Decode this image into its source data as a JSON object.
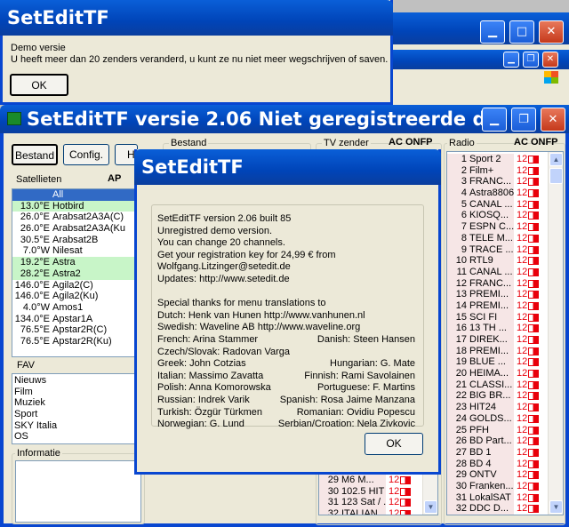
{
  "background_app": {
    "title": "SetEditTF versie  2.06  Niet geregistreerde d...",
    "buttons": {
      "bestand": "Bestand",
      "config": "Config.",
      "h": "H"
    },
    "groups": {
      "satellieten": "Satellieten",
      "bestand": "Bestand",
      "tv_zender": "TV zender",
      "radio": "Radio",
      "fav": "FAV",
      "informatie": "Informatie"
    },
    "sat_cols": "AP",
    "tv_cols": "AC ONFP",
    "radio_cols": "AC ONFP",
    "satellites": [
      {
        "pos": "",
        "name": "All",
        "hl": "sel"
      },
      {
        "pos": "13.0°E",
        "name": "Hotbird",
        "hl": "green"
      },
      {
        "pos": "26.0°E",
        "name": "Arabsat2A3A(C)",
        "hl": ""
      },
      {
        "pos": "26.0°E",
        "name": "Arabsat2A3A(Ku",
        "hl": ""
      },
      {
        "pos": "30.5°E",
        "name": "Arabsat2B",
        "hl": ""
      },
      {
        "pos": "7.0°W",
        "name": "Nilesat",
        "hl": ""
      },
      {
        "pos": "19.2°E",
        "name": "Astra",
        "hl": "green"
      },
      {
        "pos": "28.2°E",
        "name": "Astra2",
        "hl": "green"
      },
      {
        "pos": "146.0°E",
        "name": "Agila2(C)",
        "hl": ""
      },
      {
        "pos": "146.0°E",
        "name": "Agila2(Ku)",
        "hl": ""
      },
      {
        "pos": "4.0°W",
        "name": "Amos1",
        "hl": ""
      },
      {
        "pos": "134.0°E",
        "name": "Apstar1A",
        "hl": ""
      },
      {
        "pos": "76.5°E",
        "name": "Apstar2R(C)",
        "hl": ""
      },
      {
        "pos": "76.5°E",
        "name": "Apstar2R(Ku)",
        "hl": ""
      }
    ],
    "fav_list": [
      "Nieuws",
      "Film",
      "Muziek",
      "Sport",
      "SKY Italia",
      "OS"
    ],
    "tv_channels": [
      {
        "num": "29",
        "name": "M6 M..."
      },
      {
        "num": "30",
        "name": "102.5 HIT ..."
      },
      {
        "num": "31",
        "name": "123 Sat / ..."
      },
      {
        "num": "32",
        "name": "ITALIAN..."
      }
    ],
    "radio_channels": [
      {
        "num": "1",
        "name": "Sport 2"
      },
      {
        "num": "2",
        "name": "Film+"
      },
      {
        "num": "3",
        "name": "FRANC..."
      },
      {
        "num": "4",
        "name": "Astra8806"
      },
      {
        "num": "5",
        "name": "CANAL ..."
      },
      {
        "num": "6",
        "name": "KIOSQ..."
      },
      {
        "num": "7",
        "name": "ESPN C..."
      },
      {
        "num": "8",
        "name": "TELE M..."
      },
      {
        "num": "9",
        "name": "TRACE ..."
      },
      {
        "num": "10",
        "name": "RTL9"
      },
      {
        "num": "11",
        "name": "CANAL ..."
      },
      {
        "num": "12",
        "name": "FRANC..."
      },
      {
        "num": "13",
        "name": "PREMI..."
      },
      {
        "num": "14",
        "name": "PREMI..."
      },
      {
        "num": "15",
        "name": "SCI FI"
      },
      {
        "num": "16",
        "name": "13 TH ..."
      },
      {
        "num": "17",
        "name": "DIREK..."
      },
      {
        "num": "18",
        "name": "PREMI..."
      },
      {
        "num": "19",
        "name": "BLUE ..."
      },
      {
        "num": "20",
        "name": "HEIMA..."
      },
      {
        "num": "21",
        "name": "CLASSI..."
      },
      {
        "num": "22",
        "name": "BIG BR..."
      },
      {
        "num": "23",
        "name": "HIT24"
      },
      {
        "num": "24",
        "name": "GOLDS..."
      },
      {
        "num": "25",
        "name": "PFH"
      },
      {
        "num": "26",
        "name": "BD Part..."
      },
      {
        "num": "27",
        "name": "BD 1"
      },
      {
        "num": "28",
        "name": "BD 4"
      },
      {
        "num": "29",
        "name": "ONTV"
      },
      {
        "num": "30",
        "name": "Franken..."
      },
      {
        "num": "31",
        "name": "LokalSAT"
      },
      {
        "num": "32",
        "name": "DDC D..."
      }
    ],
    "flag_text": "12"
  },
  "demo_dialog": {
    "title": "SetEditTF",
    "line1": "Demo versie",
    "line2": "U heeft meer dan 20 zenders veranderd, u kunt ze nu niet meer wegschrijven of saven.",
    "ok": "OK"
  },
  "about_dialog": {
    "title": "SetEditTF",
    "lines": [
      "SetEditTF version 2.06 built 85",
      "Unregistred demo version.",
      "You can change 20 channels.",
      "Get your registration key for 24,99 € from",
      "Wolfgang.Litzinger@setedit.de",
      "Updates: http://www.setedit.de"
    ],
    "thanks": "Special thanks for menu translations to",
    "credits": [
      {
        "left": "Dutch: Henk van Hunen http://www.vanhunen.nl",
        "right": ""
      },
      {
        "left": "Swedish: Waveline AB http://www.waveline.org",
        "right": ""
      },
      {
        "left": "French: Arina Stammer",
        "right": "Danish: Steen Hansen"
      },
      {
        "left": "Czech/Slovak: Radovan Varga",
        "right": ""
      },
      {
        "left": "Greek: John Cotzias",
        "right": "Hungarian: G. Mate"
      },
      {
        "left": "Italian: Massimo Zavatta",
        "right": "Finnish: Rami Savolainen"
      },
      {
        "left": "Polish: Anna Komorowska",
        "right": "Portuguese: F. Martins"
      },
      {
        "left": "Russian: Indrek Varik",
        "right": "Spanish: Rosa Jaime Manzana"
      },
      {
        "left": "Turkish: Özgür Türkmen",
        "right": "Romanian: Ovidiu Popescu"
      },
      {
        "left": "Norwegian: G. Lund",
        "right": "Serbian/Croation: Nela Zivkovic"
      }
    ],
    "ok": "OK"
  }
}
